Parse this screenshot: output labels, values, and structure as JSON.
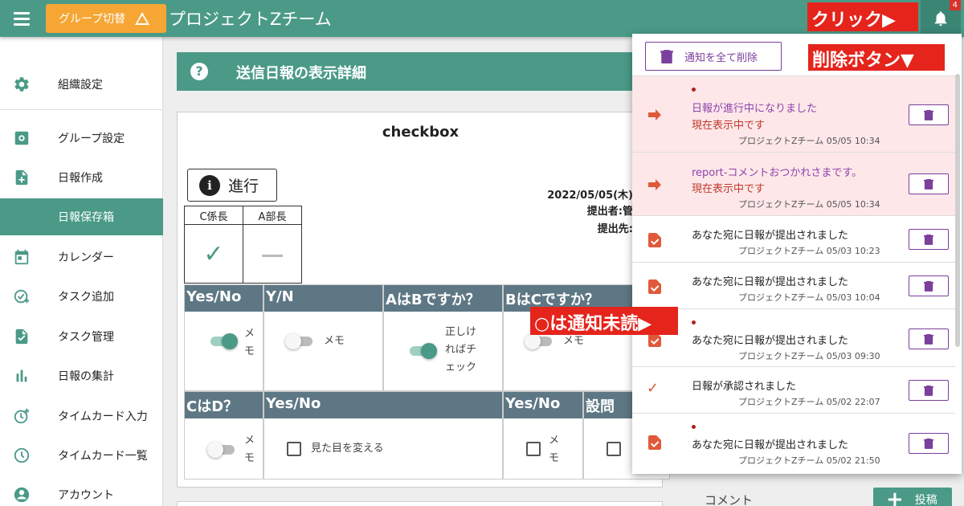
{
  "header": {
    "group_switch_label": "グループ切替",
    "app_title": "プロジェクトZチーム",
    "notification_badge": "4"
  },
  "annotations": {
    "click": "クリック▶",
    "delete": "削除ボタン▼",
    "unread": "○は通知未読▶"
  },
  "sidebar": {
    "items": [
      {
        "label": "組織設定",
        "icon": "gear-icon"
      },
      {
        "label": "グループ設定",
        "icon": "group-gear-icon"
      },
      {
        "label": "日報作成",
        "icon": "add-document-icon"
      },
      {
        "label": "日報保存箱",
        "icon": "archive-icon"
      },
      {
        "label": "カレンダー",
        "icon": "calendar-icon"
      },
      {
        "label": "タスク追加",
        "icon": "task-add-icon"
      },
      {
        "label": "タスク管理",
        "icon": "task-check-icon"
      },
      {
        "label": "日報の集計",
        "icon": "bar-chart-icon"
      },
      {
        "label": "タイムカード入力",
        "icon": "clock-add-icon"
      },
      {
        "label": "タイムカード一覧",
        "icon": "clock-icon"
      },
      {
        "label": "アカウント",
        "icon": "account-icon"
      }
    ]
  },
  "main": {
    "title": "送信日報の表示詳細",
    "card_title": "checkbox",
    "status_label": "進行",
    "date": "2022/05/05(木)",
    "submitter": "提出者:管",
    "recipient": "提出先:",
    "approvals": [
      {
        "role": "C係長",
        "state": "approved"
      },
      {
        "role": "A部長",
        "state": "none"
      }
    ],
    "fields": [
      {
        "header": "Yes/No",
        "type": "toggle",
        "on": true,
        "text": "メモ"
      },
      {
        "header": "Y/N",
        "type": "toggle",
        "on": false,
        "text": "メモ"
      },
      {
        "header": "AはBですか？",
        "type": "toggle",
        "on": true,
        "text": "正しければチェック"
      },
      {
        "header": "BはCですか？",
        "type": "toggle",
        "on": false,
        "text": "メモ"
      },
      {
        "header": "CはD？",
        "type": "toggle",
        "on": false,
        "text": "メモ"
      },
      {
        "header": "Yes/No",
        "type": "checkbox",
        "checked": false,
        "text": "見た目を変える"
      },
      {
        "header": "Yes/No",
        "type": "checkbox",
        "checked": false,
        "text": "メモ"
      },
      {
        "header": "設問",
        "type": "checkbox",
        "checked": false,
        "text": ""
      }
    ],
    "comment_label": "コメント",
    "post_label": "投稿"
  },
  "notifications": {
    "delete_all_label": "通知を全て削除",
    "items": [
      {
        "unread": true,
        "icon": "arrow-right-icon",
        "message": "日報が進行中になりました",
        "sub": "現在表示中です",
        "meta": "プロジェクトZチーム 05/05 10:34",
        "highlight": true
      },
      {
        "unread": false,
        "icon": "arrow-right-icon",
        "message": "report-コメントおつかれさまです。",
        "sub": "現在表示中です",
        "meta": "プロジェクトZチーム 05/05 10:34",
        "highlight": true
      },
      {
        "unread": false,
        "icon": "document-check-icon",
        "message": "あなた宛に日報が提出されました",
        "sub": "",
        "meta": "プロジェクトZチーム 05/03 10:23",
        "highlight": false
      },
      {
        "unread": false,
        "icon": "document-check-icon",
        "message": "あなた宛に日報が提出されました",
        "sub": "",
        "meta": "プロジェクトZチーム 05/03 10:04",
        "highlight": false
      },
      {
        "unread": true,
        "icon": "document-check-icon",
        "message": "あなた宛に日報が提出されました",
        "sub": "",
        "meta": "プロジェクトZチーム 05/03 09:30",
        "highlight": false
      },
      {
        "unread": false,
        "icon": "check-icon",
        "message": "日報が承認されました",
        "sub": "",
        "meta": "プロジェクトZチーム 05/02 22:07",
        "highlight": false
      },
      {
        "unread": true,
        "icon": "document-check-icon",
        "message": "あなた宛に日報が提出されました",
        "sub": "",
        "meta": "プロジェクトZチーム 05/02 21:50",
        "highlight": false
      }
    ]
  },
  "colors": {
    "primary": "#4a9a87",
    "accent": "#f5a634",
    "header_cell": "#5e7784",
    "notification_purple": "#7b3f9c",
    "annotation_red": "#e5241c",
    "unread_bg": "#fde7e9"
  }
}
